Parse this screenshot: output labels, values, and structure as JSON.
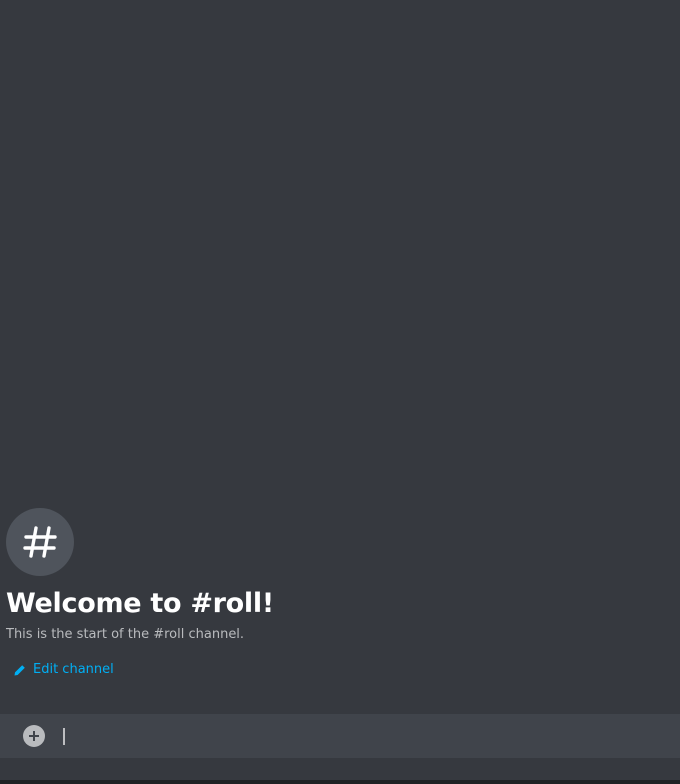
{
  "channel": {
    "icon": "hash-icon",
    "welcome_title": "Welcome to #roll!",
    "welcome_subtitle": "This is the start of the #roll channel.",
    "edit_label": "Edit channel",
    "edit_icon": "pencil-icon"
  },
  "composer": {
    "attach_icon": "plus-circle-icon",
    "value": "",
    "placeholder": ""
  },
  "colors": {
    "background": "#36393f",
    "composer": "#40444b",
    "accent_link": "#00aff4",
    "title": "#ffffff",
    "subtitle": "#b9bbbe"
  }
}
